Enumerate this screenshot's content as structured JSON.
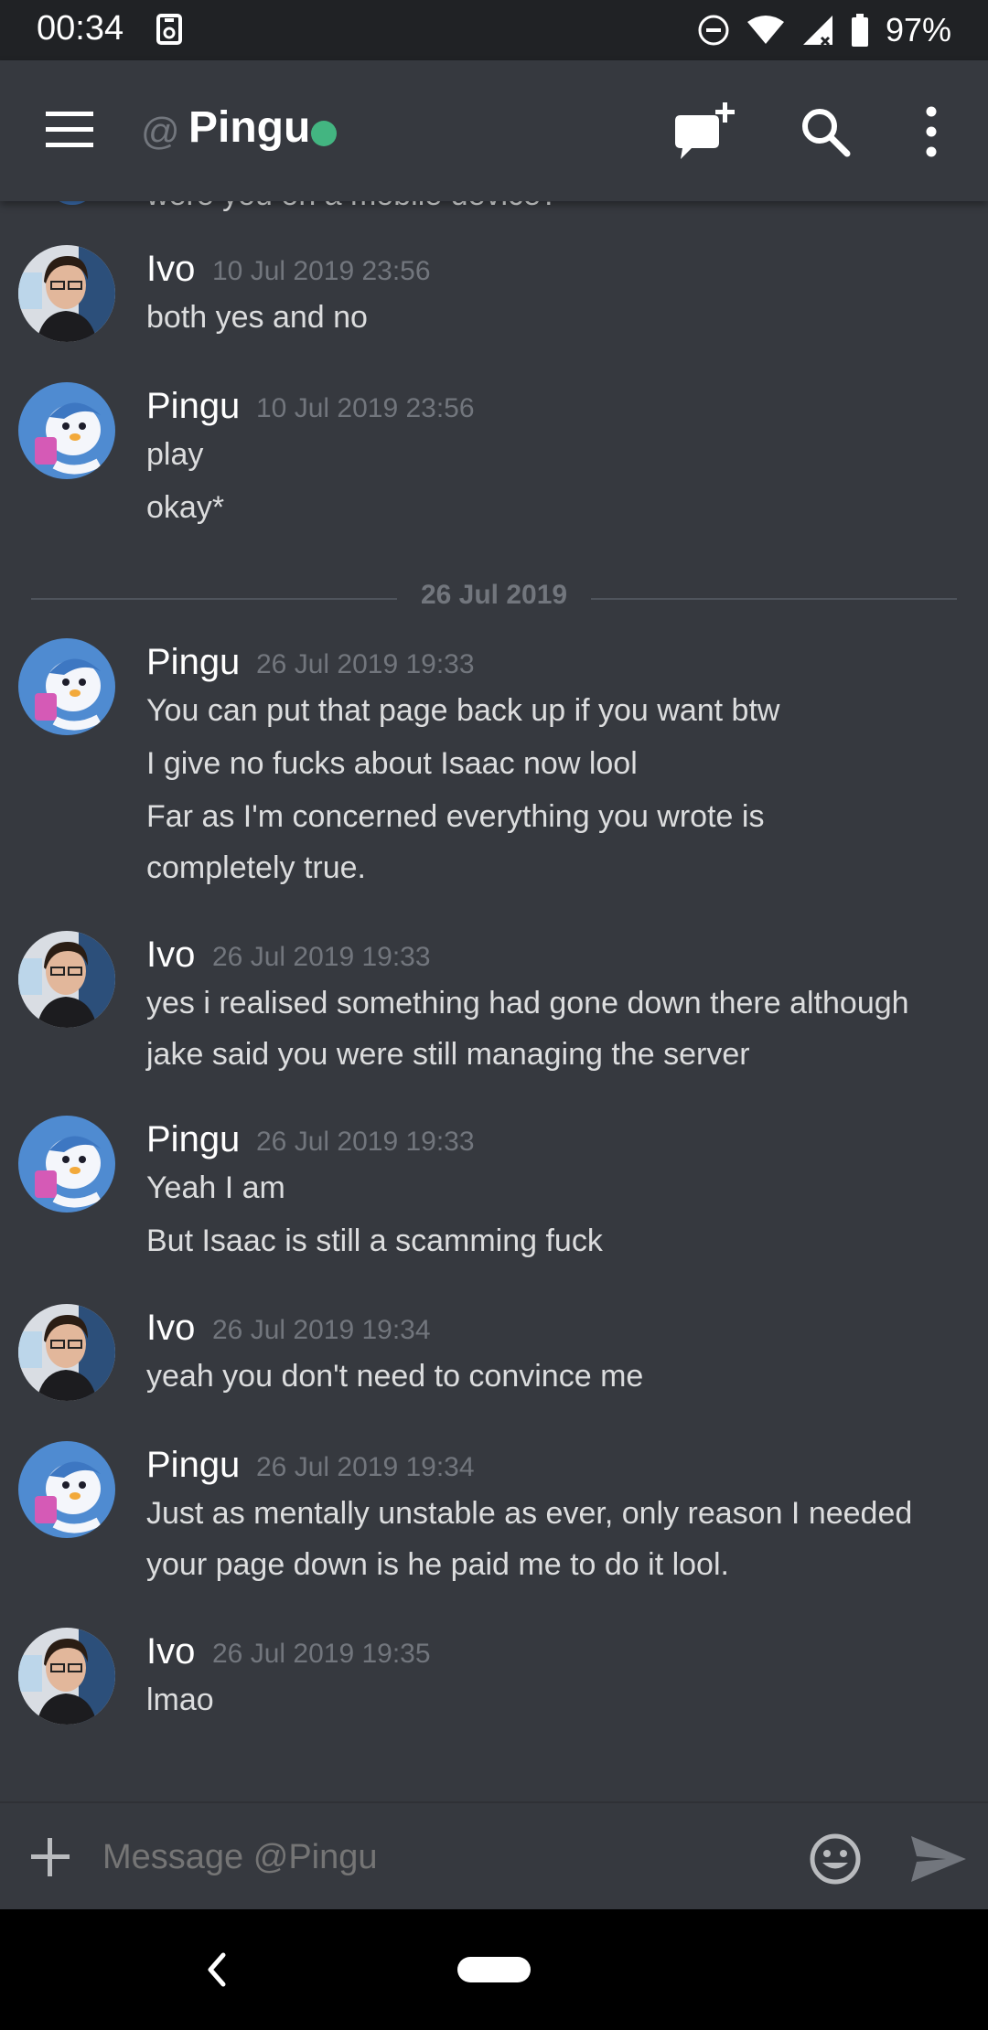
{
  "status_bar": {
    "time": "00:34",
    "battery_percent": "97%",
    "icons": [
      "storage-icon",
      "do-not-disturb-icon",
      "wifi-icon",
      "cell-signal-icon",
      "battery-icon"
    ]
  },
  "header": {
    "at_symbol": "@",
    "channel_name": "Pingu",
    "online_status_color": "#43b581",
    "icons": [
      "hamburger-menu-icon",
      "new-dm-icon",
      "search-icon",
      "more-options-icon"
    ]
  },
  "messages": {
    "cut_off_text": "were you on a mobile device?",
    "items": [
      {
        "author": "Ivo",
        "timestamp": "10 Jul 2019 23:56",
        "lines": [
          "both yes and no"
        ]
      },
      {
        "author": "Pingu",
        "timestamp": "10 Jul 2019 23:56",
        "lines": [
          "play",
          "okay*"
        ]
      },
      {
        "author": "Pingu",
        "timestamp": "26 Jul 2019 19:33",
        "lines": [
          "You can put that page back up if you want btw",
          "I give no fucks about Isaac now lool",
          "Far as I'm concerned everything you wrote is",
          "completely true."
        ]
      },
      {
        "author": "Ivo",
        "timestamp": "26 Jul 2019 19:33",
        "lines": [
          "yes i realised something had gone down there although",
          "jake said you were still managing the server"
        ]
      },
      {
        "author": "Pingu",
        "timestamp": "26 Jul 2019 19:33",
        "lines": [
          "Yeah I am",
          "But Isaac is still a scamming fuck"
        ]
      },
      {
        "author": "Ivo",
        "timestamp": "26 Jul 2019 19:34",
        "lines": [
          "yeah you don't need to convince me"
        ]
      },
      {
        "author": "Pingu",
        "timestamp": "26 Jul 2019 19:34",
        "lines": [
          "Just as mentally unstable as ever, only reason I needed",
          "your page down is he paid me to do it lool."
        ]
      },
      {
        "author": "Ivo",
        "timestamp": "26 Jul 2019 19:35",
        "lines": [
          "lmao"
        ]
      }
    ],
    "date_divider": "26 Jul 2019"
  },
  "composer": {
    "placeholder": "Message @Pingu",
    "icons": [
      "add-attachment-icon",
      "emoji-icon",
      "send-icon"
    ]
  },
  "nav_bar": {
    "icons": [
      "back-icon",
      "home-pill-icon"
    ]
  },
  "colors": {
    "background": "#36393f",
    "status_bar": "#202225",
    "online": "#43b581",
    "muted_text": "#72767d"
  }
}
